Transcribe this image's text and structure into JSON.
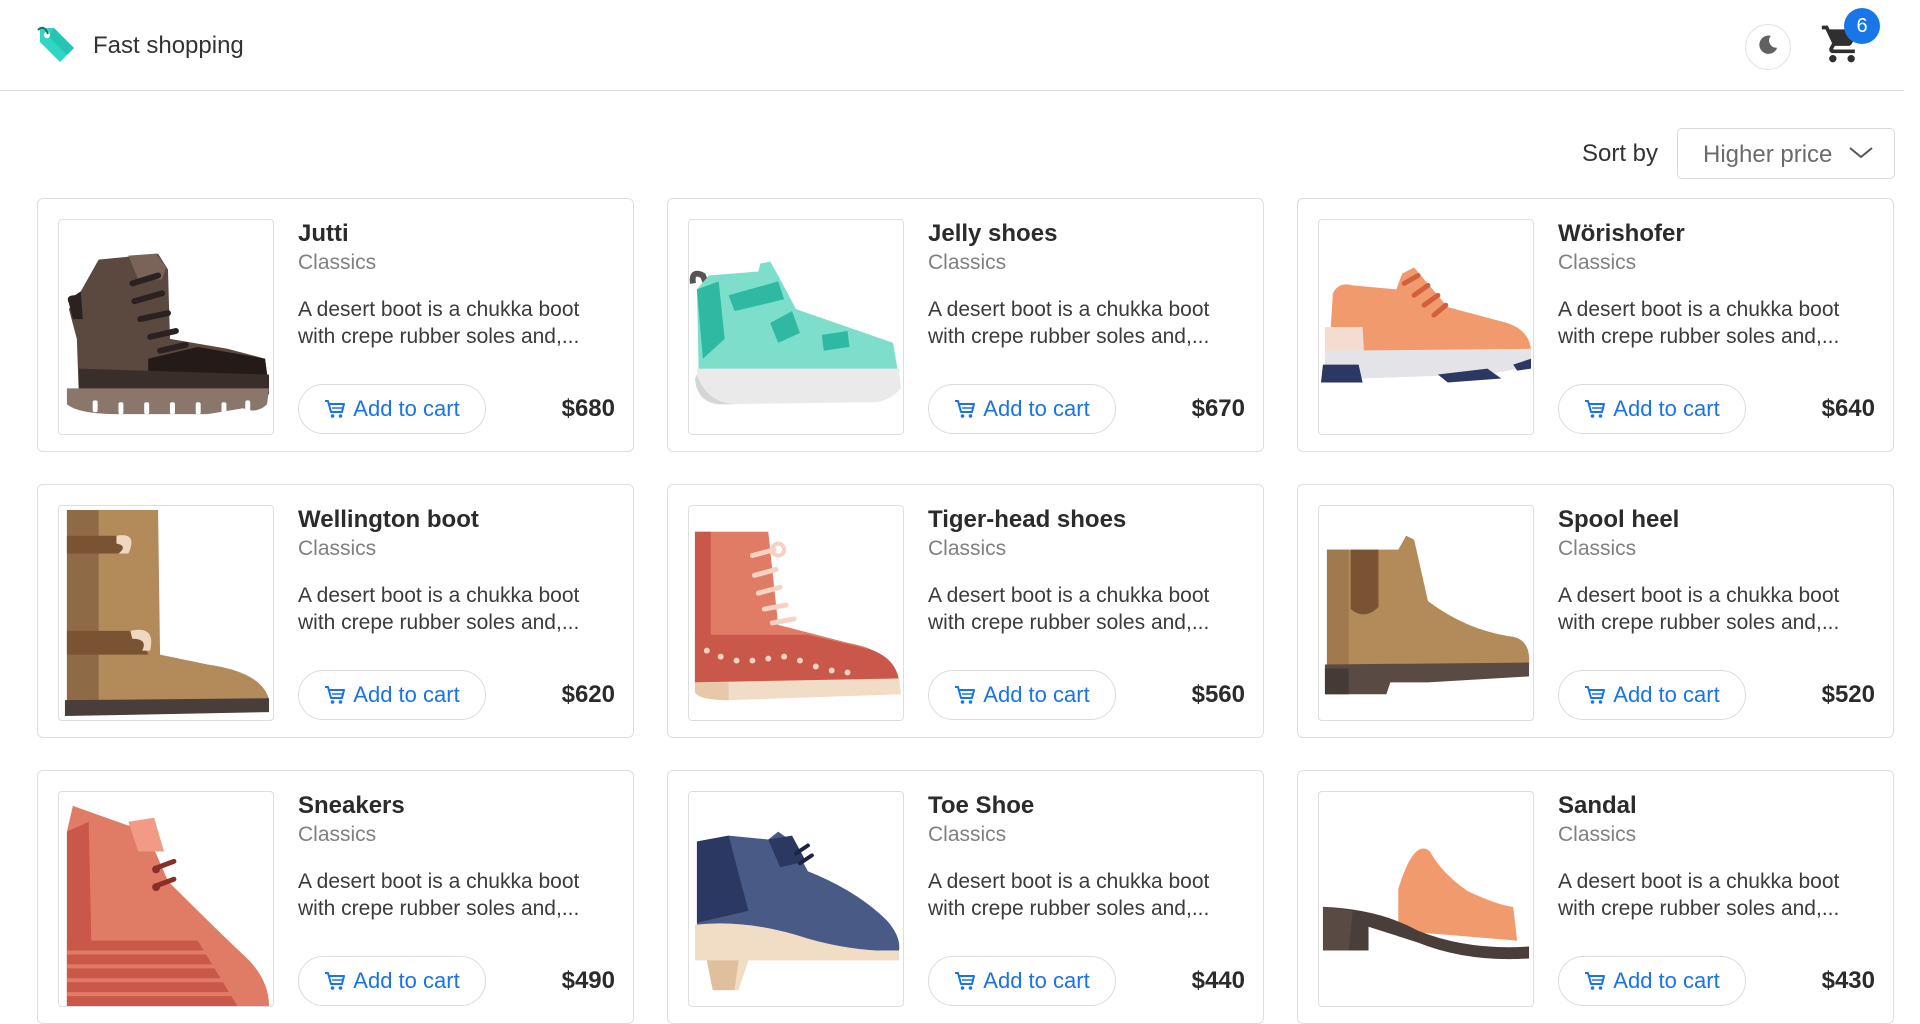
{
  "header": {
    "app_name": "Fast shopping",
    "cart_count": "6",
    "brand_icon": "price-tag-icon",
    "theme_icon": "moon-icon",
    "cart_icon": "shopping-cart-icon"
  },
  "sort": {
    "label": "Sort by",
    "selected": "Higher price"
  },
  "colors": {
    "accent": "#1a73e8",
    "badge": "#1976e8",
    "brand_icon": "#2fd6c3"
  },
  "products": [
    {
      "name": "Jutti",
      "category": "Classics",
      "desc_line1": "A desert boot is a chukka boot",
      "desc_line2": "with crepe rubber soles and,...",
      "button": "Add to cart",
      "price": "$680",
      "image": "hiking-boot-illustration"
    },
    {
      "name": "Jelly shoes",
      "category": "Classics",
      "desc_line1": "A desert boot is a chukka boot",
      "desc_line2": "with crepe rubber soles and,...",
      "button": "Add to cart",
      "price": "$670",
      "image": "velcro-sneaker-illustration"
    },
    {
      "name": "Wörishofer",
      "category": "Classics",
      "desc_line1": "A desert boot is a chukka boot",
      "desc_line2": "with crepe rubber soles and,...",
      "button": "Add to cart",
      "price": "$640",
      "image": "running-shoe-illustration"
    },
    {
      "name": "Wellington boot",
      "category": "Classics",
      "desc_line1": "A desert boot is a chukka boot",
      "desc_line2": "with crepe rubber soles and,...",
      "button": "Add to cart",
      "price": "$620",
      "image": "tall-boot-illustration"
    },
    {
      "name": "Tiger-head shoes",
      "category": "Classics",
      "desc_line1": "A desert boot is a chukka boot",
      "desc_line2": "with crepe rubber soles and,...",
      "button": "Add to cart",
      "price": "$560",
      "image": "lace-up-boot-illustration"
    },
    {
      "name": "Spool heel",
      "category": "Classics",
      "desc_line1": "A desert boot is a chukka boot",
      "desc_line2": "with crepe rubber soles and,...",
      "button": "Add to cart",
      "price": "$520",
      "image": "chelsea-boot-illustration"
    },
    {
      "name": "Sneakers",
      "category": "Classics",
      "desc_line1": "A desert boot is a chukka boot",
      "desc_line2": "with crepe rubber soles and,...",
      "button": "Add to cart",
      "price": "$490",
      "image": "wedge-bootie-illustration"
    },
    {
      "name": "Toe Shoe",
      "category": "Classics",
      "desc_line1": "A desert boot is a chukka boot",
      "desc_line2": "with crepe rubber soles and,...",
      "button": "Add to cart",
      "price": "$440",
      "image": "oxford-heel-illustration"
    },
    {
      "name": "Sandal",
      "category": "Classics",
      "desc_line1": "A desert boot is a chukka boot",
      "desc_line2": "with crepe rubber soles and,...",
      "button": "Add to cart",
      "price": "$430",
      "image": "heeled-sandal-illustration"
    }
  ]
}
